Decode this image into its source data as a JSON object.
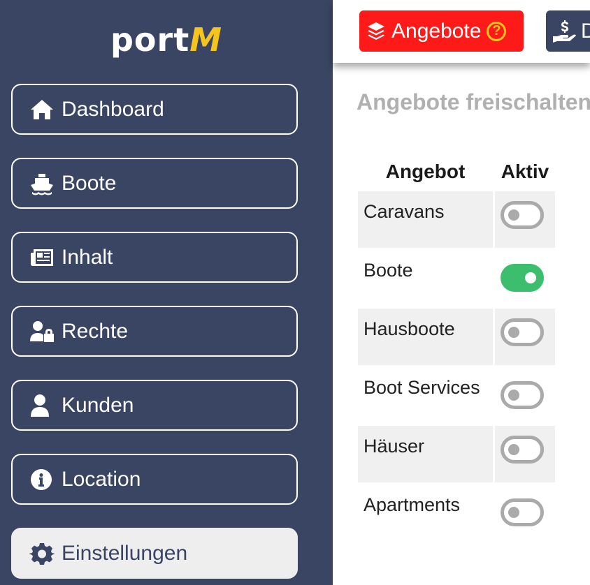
{
  "sidebar": {
    "logo_text": "port",
    "logo_accent": "M",
    "items": [
      {
        "label": "Dashboard",
        "icon": "home-icon"
      },
      {
        "label": "Boote",
        "icon": "ship-icon"
      },
      {
        "label": "Inhalt",
        "icon": "newspaper-icon"
      },
      {
        "label": "Rechte",
        "icon": "user-lock-icon"
      },
      {
        "label": "Kunden",
        "icon": "user-icon"
      },
      {
        "label": "Location",
        "icon": "info-circle-icon"
      },
      {
        "label": "Einstellungen",
        "icon": "gear-icon",
        "active": true
      }
    ]
  },
  "topbar": {
    "angebote_label": "Angebote",
    "help_symbol": "?",
    "second_button_visible_text": "D"
  },
  "main": {
    "title": "Angebote freischalten",
    "table": {
      "headers": [
        "Angebot",
        "Aktiv"
      ],
      "rows": [
        {
          "name": "Caravans",
          "active": false
        },
        {
          "name": "Boote",
          "active": true
        },
        {
          "name": "Hausboote",
          "active": false
        },
        {
          "name": "Boot Services",
          "active": false
        },
        {
          "name": "Häuser",
          "active": false
        },
        {
          "name": "Apartments",
          "active": false
        }
      ]
    }
  },
  "colors": {
    "sidebar_bg": "#3a4563",
    "logo_accent": "#f5c51e",
    "angebote_button": "#ff1a1a",
    "toggle_on": "#3dbe6f",
    "toggle_off": "#aaaaaa"
  }
}
